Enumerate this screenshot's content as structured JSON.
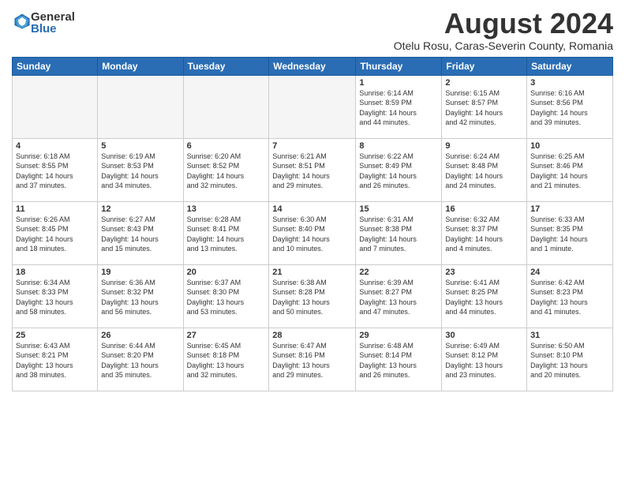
{
  "logo": {
    "general": "General",
    "blue": "Blue"
  },
  "title": {
    "month_year": "August 2024",
    "location": "Otelu Rosu, Caras-Severin County, Romania"
  },
  "headers": [
    "Sunday",
    "Monday",
    "Tuesday",
    "Wednesday",
    "Thursday",
    "Friday",
    "Saturday"
  ],
  "weeks": [
    [
      {
        "day": "",
        "info": ""
      },
      {
        "day": "",
        "info": ""
      },
      {
        "day": "",
        "info": ""
      },
      {
        "day": "",
        "info": ""
      },
      {
        "day": "1",
        "info": "Sunrise: 6:14 AM\nSunset: 8:59 PM\nDaylight: 14 hours\nand 44 minutes."
      },
      {
        "day": "2",
        "info": "Sunrise: 6:15 AM\nSunset: 8:57 PM\nDaylight: 14 hours\nand 42 minutes."
      },
      {
        "day": "3",
        "info": "Sunrise: 6:16 AM\nSunset: 8:56 PM\nDaylight: 14 hours\nand 39 minutes."
      }
    ],
    [
      {
        "day": "4",
        "info": "Sunrise: 6:18 AM\nSunset: 8:55 PM\nDaylight: 14 hours\nand 37 minutes."
      },
      {
        "day": "5",
        "info": "Sunrise: 6:19 AM\nSunset: 8:53 PM\nDaylight: 14 hours\nand 34 minutes."
      },
      {
        "day": "6",
        "info": "Sunrise: 6:20 AM\nSunset: 8:52 PM\nDaylight: 14 hours\nand 32 minutes."
      },
      {
        "day": "7",
        "info": "Sunrise: 6:21 AM\nSunset: 8:51 PM\nDaylight: 14 hours\nand 29 minutes."
      },
      {
        "day": "8",
        "info": "Sunrise: 6:22 AM\nSunset: 8:49 PM\nDaylight: 14 hours\nand 26 minutes."
      },
      {
        "day": "9",
        "info": "Sunrise: 6:24 AM\nSunset: 8:48 PM\nDaylight: 14 hours\nand 24 minutes."
      },
      {
        "day": "10",
        "info": "Sunrise: 6:25 AM\nSunset: 8:46 PM\nDaylight: 14 hours\nand 21 minutes."
      }
    ],
    [
      {
        "day": "11",
        "info": "Sunrise: 6:26 AM\nSunset: 8:45 PM\nDaylight: 14 hours\nand 18 minutes."
      },
      {
        "day": "12",
        "info": "Sunrise: 6:27 AM\nSunset: 8:43 PM\nDaylight: 14 hours\nand 15 minutes."
      },
      {
        "day": "13",
        "info": "Sunrise: 6:28 AM\nSunset: 8:41 PM\nDaylight: 14 hours\nand 13 minutes."
      },
      {
        "day": "14",
        "info": "Sunrise: 6:30 AM\nSunset: 8:40 PM\nDaylight: 14 hours\nand 10 minutes."
      },
      {
        "day": "15",
        "info": "Sunrise: 6:31 AM\nSunset: 8:38 PM\nDaylight: 14 hours\nand 7 minutes."
      },
      {
        "day": "16",
        "info": "Sunrise: 6:32 AM\nSunset: 8:37 PM\nDaylight: 14 hours\nand 4 minutes."
      },
      {
        "day": "17",
        "info": "Sunrise: 6:33 AM\nSunset: 8:35 PM\nDaylight: 14 hours\nand 1 minute."
      }
    ],
    [
      {
        "day": "18",
        "info": "Sunrise: 6:34 AM\nSunset: 8:33 PM\nDaylight: 13 hours\nand 58 minutes."
      },
      {
        "day": "19",
        "info": "Sunrise: 6:36 AM\nSunset: 8:32 PM\nDaylight: 13 hours\nand 56 minutes."
      },
      {
        "day": "20",
        "info": "Sunrise: 6:37 AM\nSunset: 8:30 PM\nDaylight: 13 hours\nand 53 minutes."
      },
      {
        "day": "21",
        "info": "Sunrise: 6:38 AM\nSunset: 8:28 PM\nDaylight: 13 hours\nand 50 minutes."
      },
      {
        "day": "22",
        "info": "Sunrise: 6:39 AM\nSunset: 8:27 PM\nDaylight: 13 hours\nand 47 minutes."
      },
      {
        "day": "23",
        "info": "Sunrise: 6:41 AM\nSunset: 8:25 PM\nDaylight: 13 hours\nand 44 minutes."
      },
      {
        "day": "24",
        "info": "Sunrise: 6:42 AM\nSunset: 8:23 PM\nDaylight: 13 hours\nand 41 minutes."
      }
    ],
    [
      {
        "day": "25",
        "info": "Sunrise: 6:43 AM\nSunset: 8:21 PM\nDaylight: 13 hours\nand 38 minutes."
      },
      {
        "day": "26",
        "info": "Sunrise: 6:44 AM\nSunset: 8:20 PM\nDaylight: 13 hours\nand 35 minutes."
      },
      {
        "day": "27",
        "info": "Sunrise: 6:45 AM\nSunset: 8:18 PM\nDaylight: 13 hours\nand 32 minutes."
      },
      {
        "day": "28",
        "info": "Sunrise: 6:47 AM\nSunset: 8:16 PM\nDaylight: 13 hours\nand 29 minutes."
      },
      {
        "day": "29",
        "info": "Sunrise: 6:48 AM\nSunset: 8:14 PM\nDaylight: 13 hours\nand 26 minutes."
      },
      {
        "day": "30",
        "info": "Sunrise: 6:49 AM\nSunset: 8:12 PM\nDaylight: 13 hours\nand 23 minutes."
      },
      {
        "day": "31",
        "info": "Sunrise: 6:50 AM\nSunset: 8:10 PM\nDaylight: 13 hours\nand 20 minutes."
      }
    ]
  ]
}
